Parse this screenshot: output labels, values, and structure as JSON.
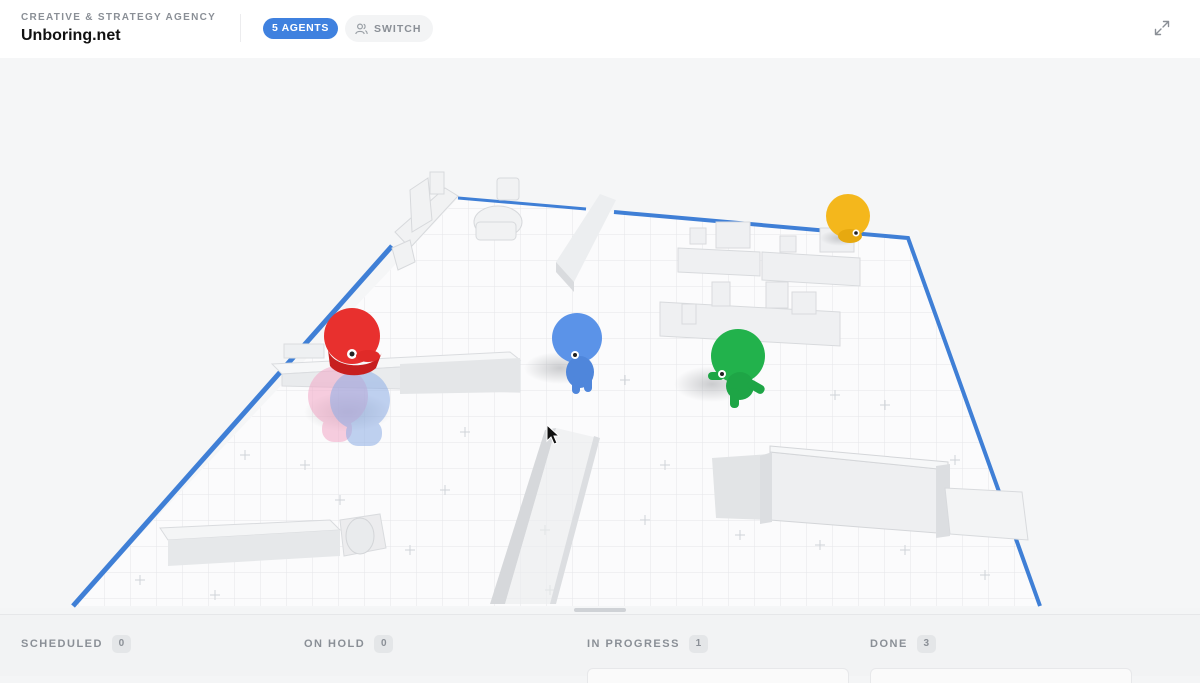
{
  "header": {
    "subtitle": "CREATIVE & STRATEGY AGENCY",
    "title": "Unboring.net",
    "agents_badge": "5 AGENTS",
    "switch_label": "SWITCH"
  },
  "icons": {
    "switch": "users-icon",
    "expand": "expand-icon",
    "cursor": "cursor-icon"
  },
  "colors": {
    "accent": "#3f81df",
    "agent_red": "#e8302e",
    "agent_blue": "#5b93e8",
    "agent_green": "#22b24c",
    "agent_yellow": "#f4b71c",
    "agent_pink": "#f2a7c6",
    "floor_border": "#3f7fd6"
  },
  "board": {
    "columns": [
      {
        "title": "SCHEDULED",
        "count": "0"
      },
      {
        "title": "ON HOLD",
        "count": "0"
      },
      {
        "title": "IN PROGRESS",
        "count": "1"
      },
      {
        "title": "DONE",
        "count": "3"
      }
    ]
  }
}
